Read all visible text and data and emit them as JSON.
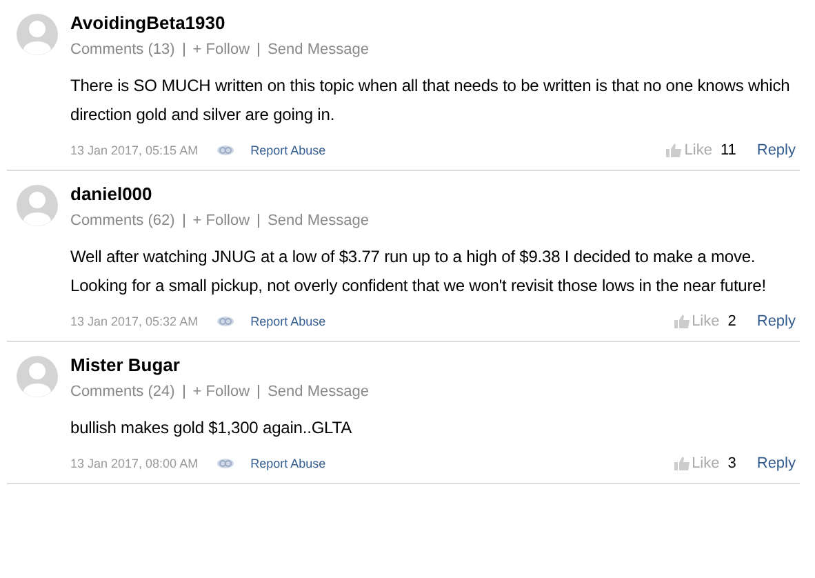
{
  "comments": [
    {
      "author": "AvoidingBeta1930",
      "comments_count": "Comments (13)",
      "follow": "+ Follow",
      "send_message": "Send Message",
      "body": "There is SO MUCH written on this topic when all that needs to be written is that no one knows which direction gold and silver are going in.",
      "timestamp": "13 Jan 2017, 05:15 AM",
      "report": "Report Abuse",
      "like_label": "Like",
      "likes": "11",
      "reply": "Reply"
    },
    {
      "author": "daniel000",
      "comments_count": "Comments (62)",
      "follow": "+ Follow",
      "send_message": "Send Message",
      "body": "Well after watching JNUG at a low of $3.77 run up to a high of $9.38 I decided to make a move. Looking for a small pickup, not overly confident that we won't revisit those lows in the near future!",
      "timestamp": "13 Jan 2017, 05:32 AM",
      "report": "Report Abuse",
      "like_label": "Like",
      "likes": "2",
      "reply": "Reply"
    },
    {
      "author": "Mister Bugar",
      "comments_count": "Comments (24)",
      "follow": "+ Follow",
      "send_message": "Send Message",
      "body": "bullish makes gold $1,300 again..GLTA",
      "timestamp": "13 Jan 2017, 08:00 AM",
      "report": "Report Abuse",
      "like_label": "Like",
      "likes": "3",
      "reply": "Reply"
    }
  ]
}
